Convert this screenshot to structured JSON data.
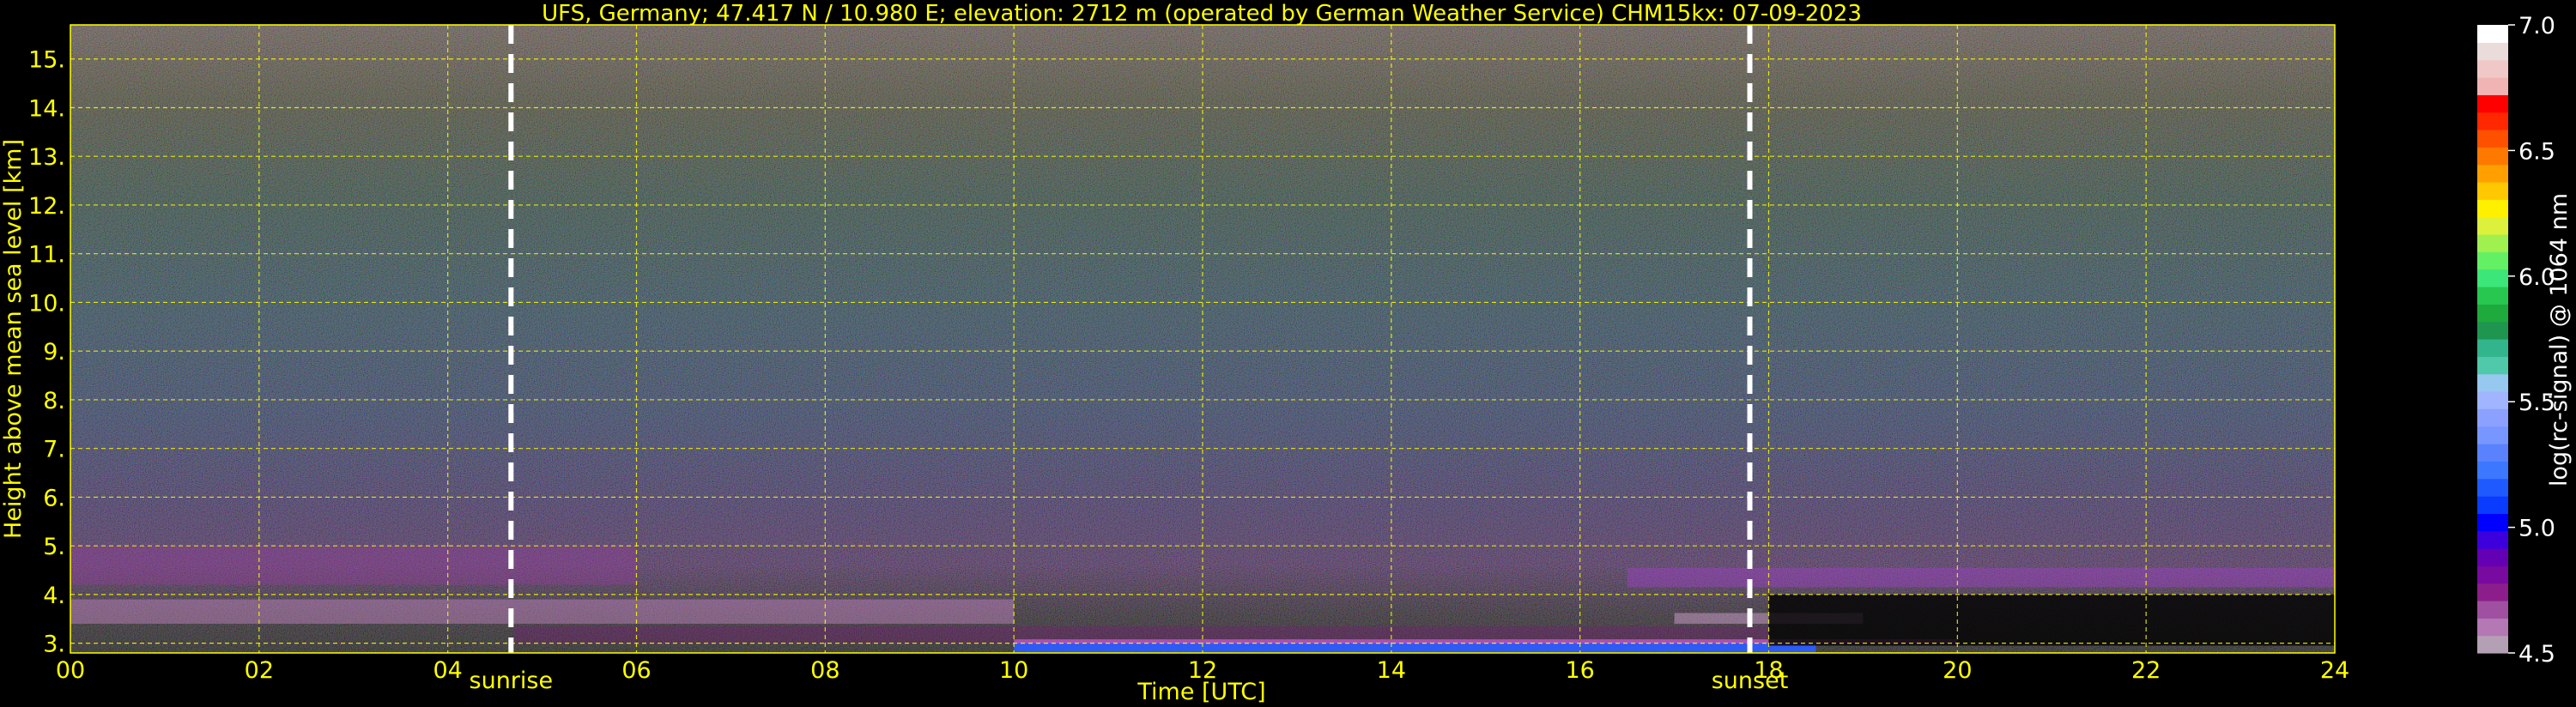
{
  "chart_data": {
    "type": "heatmap",
    "title": "UFS, Germany; 47.417 N / 10.980 E; elevation: 2712 m  (operated by German Weather Service)    CHM15kx: 07-09-2023",
    "xlabel": "Time [UTC]",
    "ylabel": "Height above mean sea level [km]",
    "xlim": [
      0,
      24
    ],
    "ylim": [
      2.8,
      15.7
    ],
    "x_ticks": [
      "00",
      "02",
      "04",
      "06",
      "08",
      "10",
      "12",
      "14",
      "16",
      "18",
      "20",
      "22",
      "24"
    ],
    "y_ticks": [
      "3.",
      "4.",
      "5.",
      "6.",
      "7.",
      "8.",
      "9.",
      "10.",
      "11.",
      "12.",
      "13.",
      "14.",
      "15."
    ],
    "grid": true,
    "grid_color": "#ffff00",
    "text_color": "#ffff00",
    "events": [
      {
        "label": "sunrise",
        "x": 4.67
      },
      {
        "label": "sunset",
        "x": 17.8
      }
    ],
    "colorbar": {
      "label": "log(rc-signal) @ 1064 nm",
      "range": [
        4.5,
        7.0
      ],
      "ticks": [
        "4.5",
        "5.0",
        "5.5",
        "6.0",
        "6.5",
        "7.0"
      ],
      "colors": [
        "#b4a0b4",
        "#b478b4",
        "#a050a0",
        "#8c1e8c",
        "#780aa0",
        "#6400b4",
        "#3c00dc",
        "#0000ff",
        "#0a3cff",
        "#1e5aff",
        "#3c78ff",
        "#5a82ff",
        "#7896ff",
        "#8ca0ff",
        "#a0b4ff",
        "#96c8f0",
        "#50c8aa",
        "#32b48c",
        "#1e9650",
        "#1eaa3c",
        "#28c850",
        "#3ce678",
        "#64f064",
        "#a0f050",
        "#dcf03c",
        "#fff000",
        "#ffc800",
        "#ffa000",
        "#ff7800",
        "#ff5000",
        "#ff2800",
        "#ff0000",
        "#f0b4b4",
        "#f0c8c8",
        "#ebdcdc",
        "#ffffff"
      ]
    }
  }
}
